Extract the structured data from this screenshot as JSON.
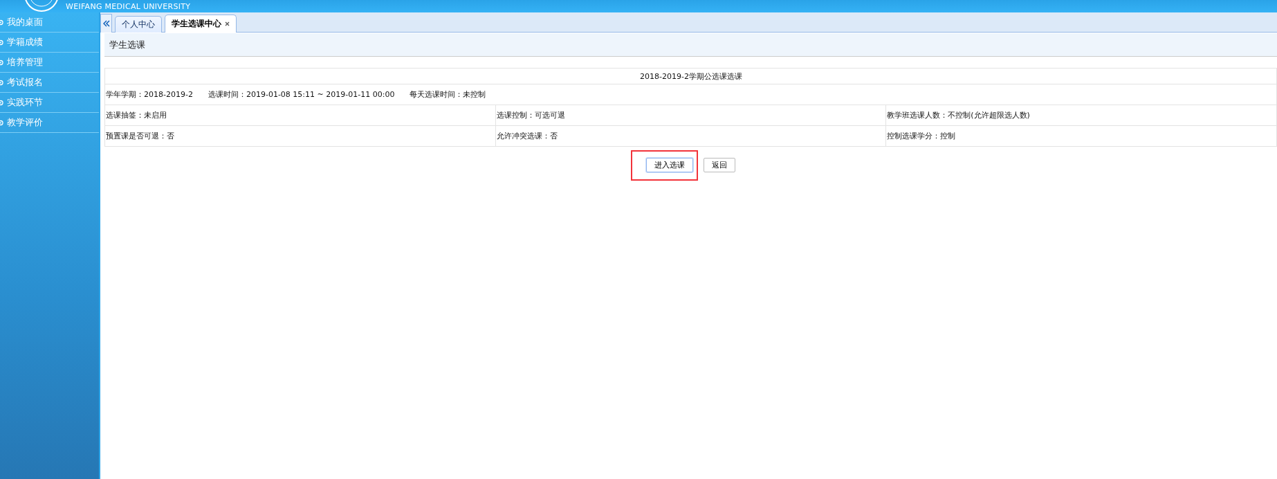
{
  "header": {
    "university_name": "WEIFANG MEDICAL UNIVERSITY"
  },
  "sidebar": {
    "items": [
      {
        "label": "我的桌面"
      },
      {
        "label": "学籍成绩"
      },
      {
        "label": "培养管理"
      },
      {
        "label": "考试报名"
      },
      {
        "label": "实践环节"
      },
      {
        "label": "教学评价"
      }
    ]
  },
  "tabs": [
    {
      "label": "个人中心",
      "selected": false,
      "closable": false
    },
    {
      "label": "学生选课中心",
      "selected": true,
      "closable": true
    }
  ],
  "panel": {
    "title": "学生选课"
  },
  "info_table": {
    "title": "2018-2019-2学期公选课选课",
    "summary": [
      "学年学期：2018-2019-2",
      "选课时间：2019-01-08 15:11 ~ 2019-01-11 00:00",
      "每天选课时间：未控制"
    ],
    "rows": [
      [
        "选课抽签：未启用",
        "选课控制：可选可退",
        "教学班选课人数：不控制(允许超限选人数)"
      ],
      [
        "预置课是否可退：否",
        "允许冲突选课：否",
        "控制选课学分：控制"
      ]
    ]
  },
  "buttons": [
    {
      "label": "进入选课",
      "kind": "primary",
      "highlighted": true
    },
    {
      "label": "返回",
      "kind": "plain",
      "highlighted": false
    }
  ]
}
